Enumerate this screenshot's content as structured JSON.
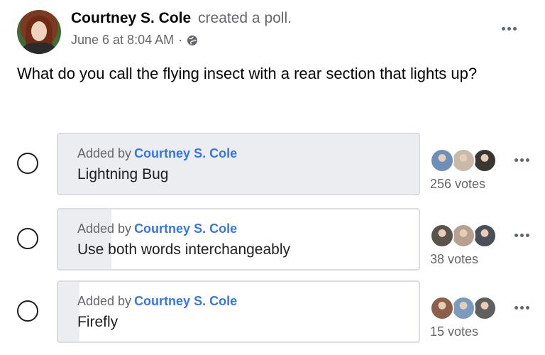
{
  "post": {
    "author": "Courtney S. Cole",
    "action": "created a poll.",
    "timestamp": "June 6 at 8:04 AM",
    "separator": "·",
    "privacy_icon": "globe-icon",
    "more_icon": "more-horizontal-icon",
    "question": "What do you call the flying insect with a rear section that lights up?"
  },
  "poll": {
    "added_by_prefix": "Added by",
    "options": [
      {
        "added_by": "Courtney S. Cole",
        "label": "Lightning Bug",
        "votes": "256 votes",
        "vote_count": 256,
        "fill_fraction": 1.0,
        "voter_colors": [
          "#6f8fb8",
          "#c9b9a8",
          "#3a3632"
        ]
      },
      {
        "added_by": "Courtney S. Cole",
        "label": "Use both words interchangeably",
        "votes": "38 votes",
        "vote_count": 38,
        "fill_fraction": 0.148,
        "voter_colors": [
          "#5a534c",
          "#b7a08f",
          "#4b5058"
        ]
      },
      {
        "added_by": "Courtney S. Cole",
        "label": "Firefly",
        "votes": "15 votes",
        "vote_count": 15,
        "fill_fraction": 0.059,
        "voter_colors": [
          "#8c5f4a",
          "#7a9bbd",
          "#5f5f5f"
        ]
      }
    ]
  },
  "colors": {
    "link_blue": "#3578e5",
    "secondary_text": "#65676b",
    "poll_fill": "#ebedf0",
    "border": "#dadde1"
  }
}
